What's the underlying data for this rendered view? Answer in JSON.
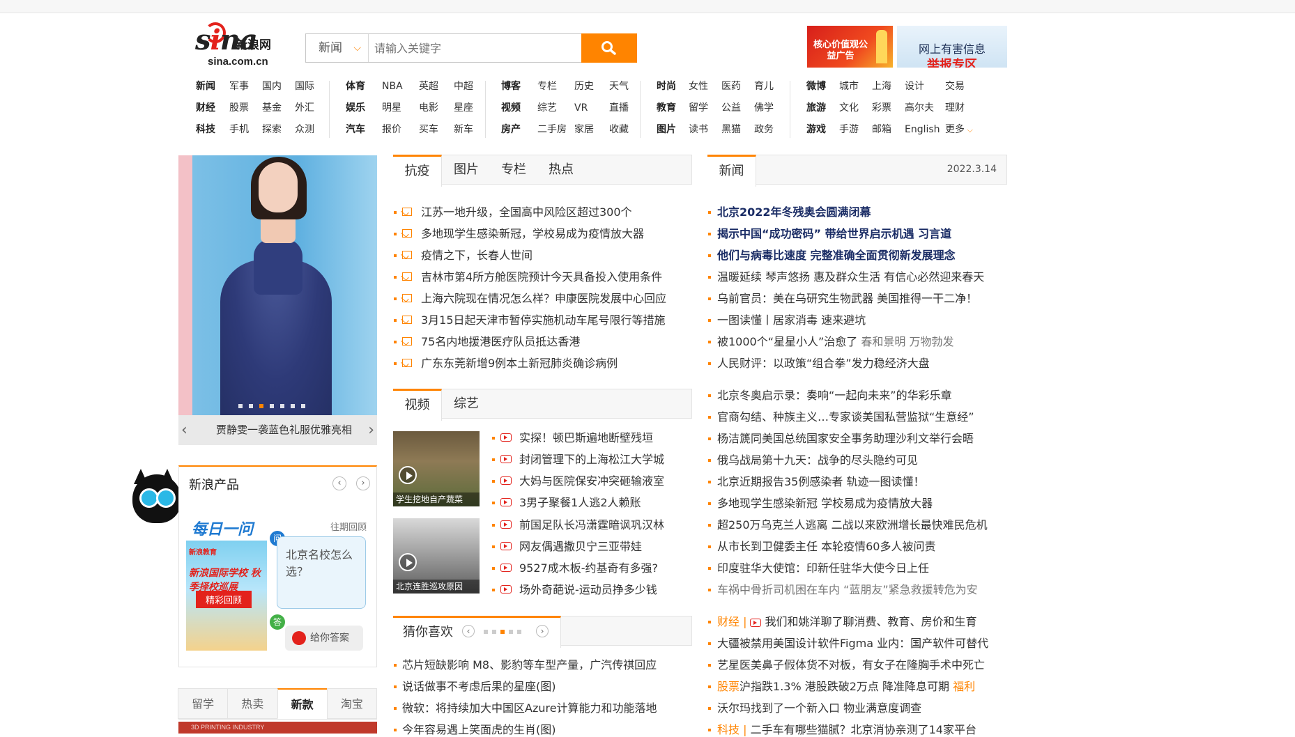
{
  "search": {
    "category": "新闻",
    "placeholder": "请输入关键字"
  },
  "logo": {
    "brand": "sina",
    "cn": "新浪网",
    "url": "sina.com.cn"
  },
  "banners": {
    "left": "核心价值观公益广告",
    "right_line1": "网上有害信息",
    "right_line2": "举报专区"
  },
  "nav": {
    "col1": [
      [
        "新闻",
        "军事",
        "国内",
        "国际"
      ],
      [
        "财经",
        "股票",
        "基金",
        "外汇"
      ],
      [
        "科技",
        "手机",
        "探索",
        "众测"
      ]
    ],
    "col2": [
      [
        "体育",
        "NBA",
        "英超",
        "中超"
      ],
      [
        "娱乐",
        "明星",
        "电影",
        "星座"
      ],
      [
        "汽车",
        "报价",
        "买车",
        "新车"
      ]
    ],
    "col3": [
      [
        "博客",
        "专栏",
        "历史",
        "天气"
      ],
      [
        "视频",
        "综艺",
        "VR",
        "直播"
      ],
      [
        "房产",
        "二手房",
        "家居",
        "收藏"
      ]
    ],
    "col4": [
      [
        "时尚",
        "女性",
        "医药",
        "育儿"
      ],
      [
        "教育",
        "留学",
        "公益",
        "佛学"
      ],
      [
        "图片",
        "读书",
        "黑猫",
        "政务"
      ]
    ],
    "col5": [
      [
        "微博",
        "城市",
        "上海",
        "设计",
        "交易"
      ],
      [
        "旅游",
        "文化",
        "彩票",
        "高尔夫",
        "理财"
      ],
      [
        "游戏",
        "手游",
        "邮箱",
        "English",
        "更多"
      ]
    ]
  },
  "slider": {
    "caption": "贾静雯一袭蓝色礼服优雅亮相"
  },
  "products": {
    "title": "新浪产品",
    "daily": "每日一问",
    "past": "往期回顾",
    "img_label": "新浪教育",
    "img_title": "新浪国际学校 秋季择校巡展",
    "img_btn": "精彩回顾",
    "question": "北京名校怎么选？",
    "answer": "给你答案",
    "q": "问",
    "a": "答"
  },
  "left_tabs": [
    "留学",
    "热卖",
    "新款",
    "淘宝"
  ],
  "left_strip": "3D PRINTING INDUSTRY",
  "mid_tabs": [
    "抗疫",
    "图片",
    "专栏",
    "热点"
  ],
  "mid_news": [
    "江苏一地升级，全国高中风险区超过300个",
    "多地现学生感染新冠，学校易成为疫情放大器",
    "疫情之下，长春人世间",
    "吉林市第4所方舱医院预计今天具备投入使用条件",
    "上海六院现在情况怎么样？申康医院发展中心回应",
    "3月15日起天津市暂停实施机动车尾号限行等措施",
    "75名内地援港医疗队员抵达香港",
    "广东东莞新增9例本土新冠肺炎确诊病例"
  ],
  "video_tabs": [
    "视频",
    "综艺"
  ],
  "video_thumbs": [
    "学生挖地自产蔬菜",
    "北京连胜巡攻原因"
  ],
  "video_news": [
    "实探！顿巴斯遍地断壁残垣",
    "封闭管理下的上海松江大学城",
    "大妈与医院保安冲突砸输液室",
    "3男子聚餐1人逃2人赖账",
    "前国足队长冯潇霆暗讽巩汉林",
    "网友偶遇撒贝宁三亚带娃",
    "9527成木板-约基奇有多强?",
    "场外奇葩说-运动员挣多少钱"
  ],
  "guess": {
    "title": "猜你喜欢",
    "items": [
      "芯片短缺影响 M8、影豹等车型产量，广汽传祺回应",
      "说话做事不考虑后果的星座(图)",
      "微软：将持续加大中国区Azure计算能力和功能落地",
      "今年容易遇上笑面虎的生肖(图)"
    ]
  },
  "right": {
    "tab": "新闻",
    "date": "2022.3.14",
    "top": [
      "北京2022年冬残奥会圆满闭幕",
      "揭示中国“成功密码” 带给世界启示机遇 习言道",
      "他们与病毒比速度 完整准确全面贯彻新发展理念"
    ],
    "list1": [
      "温暖延续 琴声悠扬 惠及群众生活 有信心必然迎来春天",
      "乌前官员：美在乌研究生物武器 美国推得一干二净！",
      "一图读懂丨居家消毒 速来避坑",
      "被1000个“星星小人”治愈了",
      "人民财评：以政策“组合拳”发力稳经济大盘"
    ],
    "list1_extra": "春和景明 万物勃发",
    "list2": [
      "北京冬奥启示录：奏响“一起向未来”的华彩乐章",
      "官商勾结、种族主义…专家谈美国私营监狱“生意经”",
      "杨洁篪同美国总统国家安全事务助理沙利文举行会晤",
      "俄乌战局第十九天：战争的尽头隐约可见",
      "北京近期报告35例感染者 轨迹一图读懂！",
      "多地现学生感染新冠 学校易成为疫情放大器",
      "超250万乌克兰人逃离 二战以来欧洲增长最快难民危机",
      "从市长到卫健委主任 本轮疫情60多人被问责",
      "印度驻华大使馆：印新任驻华大使今日上任",
      "车祸中骨折司机困在车内 “蓝朋友”紧急救援转危为安"
    ],
    "finance": {
      "tag": "财经",
      "sep": " |",
      "headline": "我们和姚洋聊了聊消费、教育、房价和生育",
      "items": [
        "大疆被禁用美国设计软件Figma 业内：国产软件可替代",
        "艺星医美鼻子假体货不对板，有女子在隆胸手术中死亡"
      ],
      "stock_tag": "股票",
      "stock_text": "沪指跌1.3% 港股跌破2万点 降准降息可期",
      "stock_extra": "福利",
      "walmart": "沃尔玛找到了一个新入口 物业满意度调查",
      "tech_tag": "科技",
      "tech_text": "二手车有哪些猫腻？北京消协亲测了14家平台"
    }
  },
  "colors": {
    "accent": "#ff8400",
    "brand_red": "#e3221c",
    "navy": "#1a2c65"
  }
}
